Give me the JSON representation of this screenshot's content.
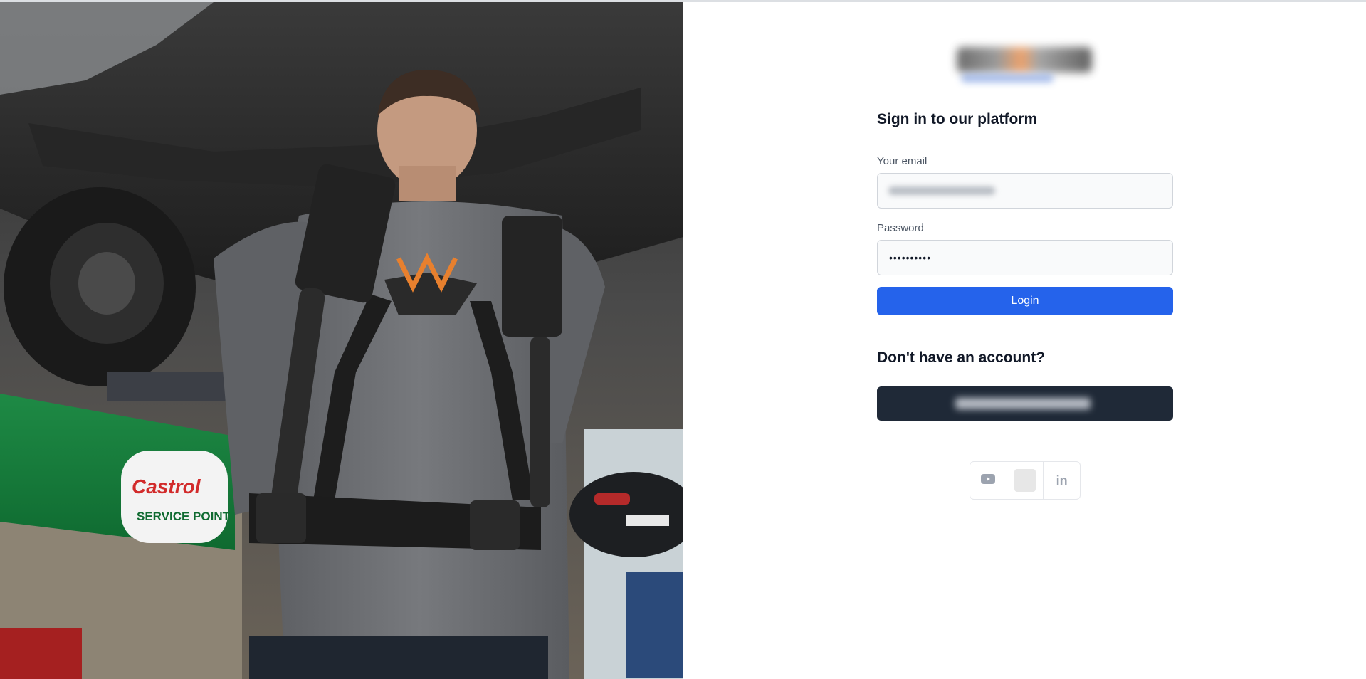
{
  "photo": {
    "alt": "Mechanic wearing exoskeleton working under a car",
    "sign_brand": "Castrol",
    "sign_sub": "SERVICE POINT"
  },
  "logo": {
    "name": "logo-blurred"
  },
  "signin": {
    "heading": "Sign in to our platform",
    "email_label": "Your email",
    "email_value": "",
    "password_label": "Password",
    "password_value": "••••••••••",
    "login_label": "Login"
  },
  "signup": {
    "heading": "Don't have an account?",
    "button_label": ""
  },
  "socials": [
    {
      "name": "youtube-icon"
    },
    {
      "name": "placeholder-icon"
    },
    {
      "name": "linkedin-icon",
      "text": "in"
    }
  ],
  "colors": {
    "primary": "#2563eb",
    "dark_button": "#1f2937",
    "heading": "#111827",
    "label": "#4b5563"
  }
}
